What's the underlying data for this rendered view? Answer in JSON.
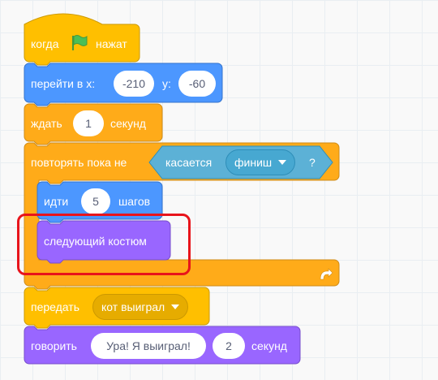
{
  "colors": {
    "events": "#ffbf00",
    "motion": "#4c97ff",
    "control": "#ffab19",
    "sensing": "#5cb1d6",
    "looks": "#9966ff",
    "highlight": "#e8141b"
  },
  "icons": {
    "green_flag": "green-flag-icon",
    "loop_arrow": "loop-arrow-icon",
    "dropdown": "dropdown-arrow-icon"
  },
  "blocks": {
    "when_flag": {
      "prefix": "когда",
      "suffix": "нажат"
    },
    "go_to": {
      "label": "перейти в x:",
      "x_value": "-210",
      "y_label": "y:",
      "y_value": "-60"
    },
    "wait": {
      "label": "ждать",
      "value": "1",
      "unit": "секунд"
    },
    "repeat_until": {
      "label": "повторять пока не",
      "condition": {
        "label": "касается",
        "target": "финиш",
        "suffix": "?"
      }
    },
    "move": {
      "label": "идти",
      "value": "5",
      "unit": "шагов"
    },
    "next_costume": {
      "label": "следующий костюм"
    },
    "broadcast": {
      "label": "передать",
      "message": "кот выиграл"
    },
    "say_for": {
      "label": "говорить",
      "text": "Ура! Я выиграл!",
      "value": "2",
      "unit": "секунд"
    }
  }
}
